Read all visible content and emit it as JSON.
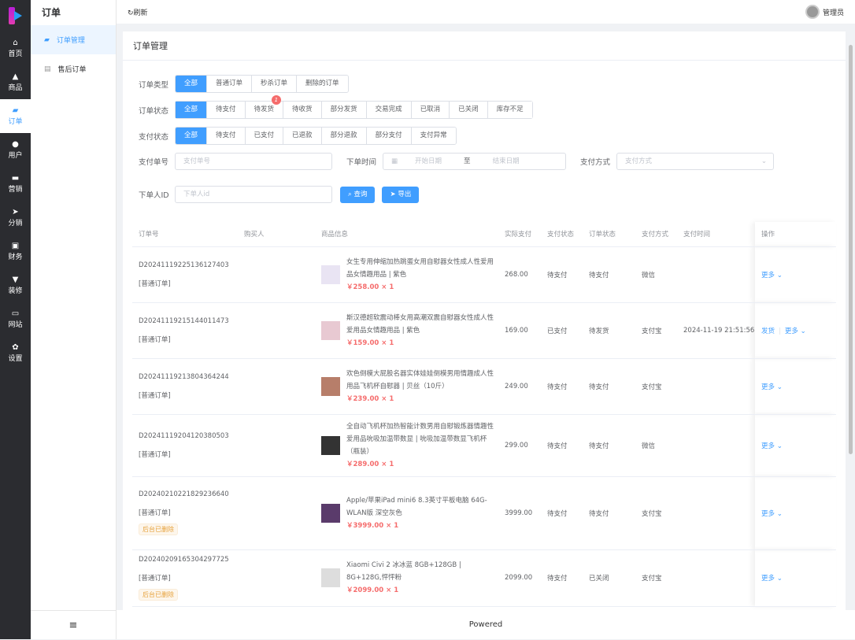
{
  "rail": [
    {
      "icon": "home-icon",
      "glyph": "⌂",
      "label": "首页"
    },
    {
      "icon": "bag-icon",
      "glyph": "▲",
      "label": "商品"
    },
    {
      "icon": "wallet-icon",
      "glyph": "▰",
      "label": "订单"
    },
    {
      "icon": "user-icon",
      "glyph": "●",
      "label": "用户"
    },
    {
      "icon": "ticket-icon",
      "glyph": "▬",
      "label": "营销"
    },
    {
      "icon": "send-icon",
      "glyph": "➤",
      "label": "分销"
    },
    {
      "icon": "finance-icon",
      "glyph": "▣",
      "label": "财务"
    },
    {
      "icon": "brush-icon",
      "glyph": "▼",
      "label": "装修"
    },
    {
      "icon": "monitor-icon",
      "glyph": "▭",
      "label": "网站"
    },
    {
      "icon": "gear-icon",
      "glyph": "✿",
      "label": "设置"
    }
  ],
  "submenu": {
    "title": "订单",
    "items": [
      {
        "label": "订单管理"
      },
      {
        "label": "售后订单"
      }
    ],
    "collapse": "≡"
  },
  "header": {
    "refresh": "↻刷新",
    "user": "管理员"
  },
  "card_title": "订单管理",
  "filters": {
    "type": {
      "label": "订单类型",
      "options": [
        "全部",
        "普通订单",
        "秒杀订单",
        "删除的订单"
      ]
    },
    "status": {
      "label": "订单状态",
      "options": [
        "全部",
        "待支付",
        "待发货",
        "待收货",
        "部分发货",
        "交易完成",
        "已取消",
        "已关闭",
        "库存不足"
      ],
      "badge": "1"
    },
    "pay": {
      "label": "支付状态",
      "options": [
        "全部",
        "待支付",
        "已支付",
        "已退款",
        "部分退款",
        "部分支付",
        "支付异常"
      ]
    },
    "payno": {
      "label": "支付单号",
      "placeholder": "支付单号"
    },
    "time": {
      "label": "下单时间",
      "start": "开始日期",
      "to": "至",
      "end": "结束日期"
    },
    "method": {
      "label": "支付方式",
      "placeholder": "支付方式"
    },
    "uid": {
      "label": "下单人ID",
      "placeholder": "下单人id"
    },
    "search": "查询",
    "export": "导出"
  },
  "columns": [
    "订单号",
    "购买人",
    "商品信息",
    "实际支付",
    "支付状态",
    "订单状态",
    "支付方式",
    "支付时间",
    "操作"
  ],
  "rows": [
    {
      "no": "D20241119225136127403",
      "type": "[普通订单]",
      "tag": "",
      "name": "女生专用伸缩加热跳蛋女用自慰器女性成人性爱用品女情趣用品 | 紫色",
      "price": "￥258.00 × 1",
      "paid": "268.00",
      "pay": "待支付",
      "status": "待支付",
      "method": "微信",
      "time": "",
      "ship": "",
      "more": "更多"
    },
    {
      "no": "D20241119215144011473",
      "type": "[普通订单]",
      "tag": "",
      "name": "斯汉德超软震动棒女用高潮双震自慰器女性成人性爱用品女情趣用品 | 紫色",
      "price": "￥159.00 × 1",
      "paid": "169.00",
      "pay": "已支付",
      "status": "待发货",
      "method": "支付宝",
      "time": "2024-11-19 21:51:56",
      "ship": "发货",
      "more": "更多"
    },
    {
      "no": "D20241119213804364244",
      "type": "[普通订单]",
      "tag": "",
      "name": "欢色倒模大屁股名器实体娃娃倒模男用情趣成人性用品飞机杯自慰器 | 贝丝（10斤）",
      "price": "￥239.00 × 1",
      "paid": "249.00",
      "pay": "待支付",
      "status": "待支付",
      "method": "支付宝",
      "time": "",
      "ship": "",
      "more": "更多"
    },
    {
      "no": "D20241119204120380503",
      "type": "[普通订单]",
      "tag": "",
      "name": "全自动飞机杯加热智能计数男用自慰锻炼器情趣性爱用品吮吸加温带数显 | 吮吸加温带数显飞机杯（瓶装）",
      "price": "￥289.00 × 1",
      "paid": "299.00",
      "pay": "待支付",
      "status": "待支付",
      "method": "微信",
      "time": "",
      "ship": "",
      "more": "更多"
    },
    {
      "no": "D20240210221829236640",
      "type": "[普通订单]",
      "tag": "后台已删除",
      "name": "Apple/苹果iPad mini6 8.3英寸平板电脑 64G-WLAN版 深空灰色",
      "price": "￥3999.00 × 1",
      "paid": "3999.00",
      "pay": "待支付",
      "status": "待支付",
      "method": "支付宝",
      "time": "",
      "ship": "",
      "more": "更多"
    },
    {
      "no": "D20240209165304297725",
      "type": "[普通订单]",
      "tag": "后台已删除",
      "name": "Xiaomi Civi 2 冰冰蓝 8GB+128GB | 8G+128G,怦怦粉",
      "price": "￥2099.00 × 1",
      "paid": "2099.00",
      "pay": "待支付",
      "status": "已关闭",
      "method": "支付宝",
      "time": "",
      "ship": "",
      "more": "更多"
    }
  ],
  "footer": "Powered",
  "colors": {
    "primary": "#409eff",
    "danger": "#f56c6c",
    "rail": "#2b2c30"
  }
}
